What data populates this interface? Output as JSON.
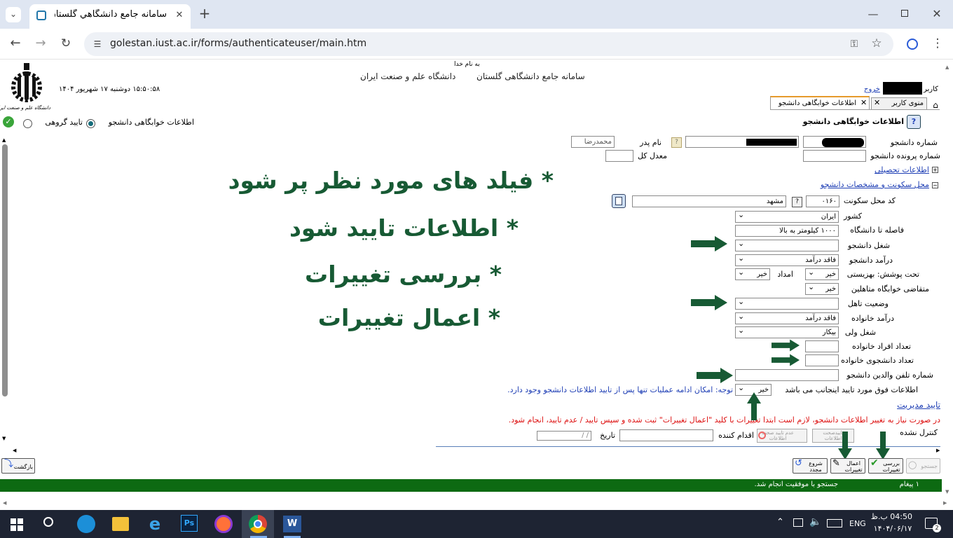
{
  "browser": {
    "tab_title": "سامانه جامع دانشگاهي گلستان -",
    "url": "golestan.iust.ac.ir/forms/authenticateuser/main.htm"
  },
  "header": {
    "bismillah": "به نام خدا",
    "system_title": "سامانه جامع دانشگاهی گلستان",
    "university": "دانشگاه علم و صنعت ایران",
    "datetime": "۱۵:۵۰:۵۸ دوشنبه ۱۷ شهریور ۱۴۰۴",
    "user_label": "کاربر",
    "logout": "خروج",
    "logo_text": "دانشگاه علم و صنعت ایران"
  },
  "tabs": [
    {
      "label": "منوی کاربر"
    },
    {
      "label": "اطلاعات خوابگاهی دانشجو"
    }
  ],
  "form": {
    "title": "اطلاعات خوابگاهی دانشجو",
    "radio_option_1": "اطلاعات خوابگاهی دانشجو",
    "radio_option_2": "تایید گروهی",
    "student_number_label": "شماره دانشجو",
    "file_number_label": "شماره پرونده دانشجو",
    "father_name_label": "نام پدر",
    "father_name_value": "محمدرضا",
    "gpa_label": "معدل کل",
    "academic_info_link": "اطلاعات تحصیلی",
    "residence_link": "محل سکونت و مشخصات دانشجو",
    "residence_code_label": "کد محل سکونت",
    "residence_code_value": "۰۱۶۰",
    "residence_city_value": "مشهد",
    "country_label": "کشور",
    "country_value": "ایران",
    "distance_label": "فاصله تا دانشگاه",
    "distance_value": "۱۰۰۰ کیلومتر به بالا",
    "job_label": "شغل دانشجو",
    "income_label": "درآمد دانشجو",
    "income_value": "فاقد درآمد",
    "coverage_label": "تحت پوشش: بهزیستی",
    "coverage_value": "خیر",
    "relief_label": "امداد",
    "relief_value": "خیر",
    "married_dorm_label": "متقاضی خوابگاه متاهلین",
    "married_dorm_value": "خیر",
    "marital_label": "وضعیت تاهل",
    "family_income_label": "درآمد خانواده",
    "family_income_value": "فاقد درآمد",
    "guardian_job_label": "شغل ولی",
    "guardian_job_value": "بیکار",
    "family_size_label": "تعداد افراد خانواده",
    "family_students_label": "تعداد دانشجوی خانواده",
    "parents_phone_label": "شماره تلفن والدین دانشجو",
    "confirm_label": "اطلاعات فوق مورد تایید اینجانب می باشد",
    "confirm_value": "خیر",
    "confirm_note": "توجه: امکان ادامه عملیات تنها پس از تایید اطلاعات دانشجو وجود دارد.",
    "management_link": "تایید مدیریت",
    "warning": "در صورت نیاز به تغییر اطلاعات دانشجو، لازم است ابتدا تغییرات با کلید \"اعمال تغییرات\" ثبت شده و سپس تایید / عدم تایید، انجام شود.",
    "control_status": "کنترل نشده",
    "approve_btn": "تاییدصحت اطلاعات",
    "reject_btn": "عدم تایید صحت اطلاعات",
    "actor_label": "اقدام کننده",
    "date_label": "تاریخ",
    "date_value": "/    /"
  },
  "annotations": {
    "line1": "* فیلد های مورد نظر پر شود",
    "line2": "* اطلاعات تایید شود",
    "line3": "* بررسی تغییرات",
    "line4": "* اعمال تغییرات"
  },
  "buttons": {
    "search": "جستجو",
    "review": "بررسی تغییرات",
    "apply": "اعمال تغییرات",
    "restart": "شروع مجدد",
    "back": "بازگشت"
  },
  "status": {
    "messages": "۱ پیغام",
    "text": "جستجو با موفقیت انجام شد."
  },
  "taskbar": {
    "lang": "ENG",
    "time": "04:50 ب.ظ",
    "date": "۱۴۰۴/۰۶/۱۷",
    "notifications": "2"
  },
  "colors": {
    "accent": "#1f3fb5",
    "annotation": "#175a34",
    "status_bar": "#0d6a12",
    "warning": "#d11"
  }
}
